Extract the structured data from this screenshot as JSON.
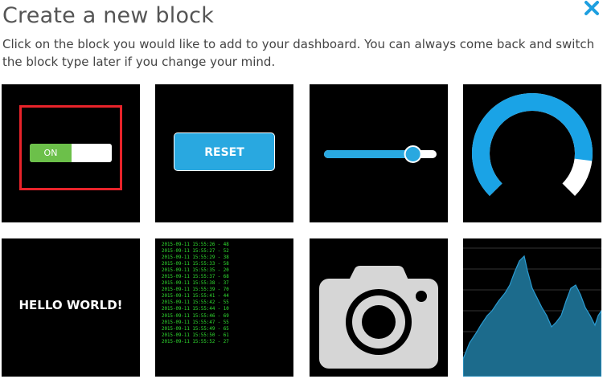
{
  "dialog": {
    "title": "Create a new block",
    "description": "Click on the block you would like to add to your dashboard. You can always come back and switch the block type later if you change your mind.",
    "close_icon": "close-icon"
  },
  "blocks": {
    "switch": {
      "on_label": "ON",
      "selected": true
    },
    "button": {
      "label": "RESET"
    },
    "slider": {
      "value": 0.79
    },
    "gauge": {
      "fill": 0.86
    },
    "text": {
      "label": "HELLO WORLD!"
    },
    "terminal": {
      "lines": [
        "2015-09-11 15:55:26 - 48",
        "2015-09-11 15:55:27 - 52",
        "2015-09-11 15:55:29 - 38",
        "2015-09-11 15:55:33 - 58",
        "2015-09-11 15:55:35 - 20",
        "2015-09-11 15:55:37 - 68",
        "2015-09-11 15:55:38 - 37",
        "2015-09-11 15:55:39 - 70",
        "2015-09-11 15:55:41 - 44",
        "2015-09-11 15:55:42 - 55",
        "2015-09-11 15:55:44 - 10",
        "2015-09-11 15:55:46 - 69",
        "2015-09-11 15:55:47 - 55",
        "2015-09-11 15:55:49 - 65",
        "2015-09-11 15:55:50 - 61",
        "2015-09-11 15:55:52 - 27"
      ]
    },
    "image": {
      "icon": "camera-icon"
    },
    "chart": {
      "icon": "area-chart-icon"
    }
  },
  "colors": {
    "accent_blue": "#29a8e0",
    "switch_green": "#6cc04a",
    "selection_red": "#e8232a",
    "terminal_green": "#31e131",
    "chart_fill": "#1c6b8c"
  }
}
